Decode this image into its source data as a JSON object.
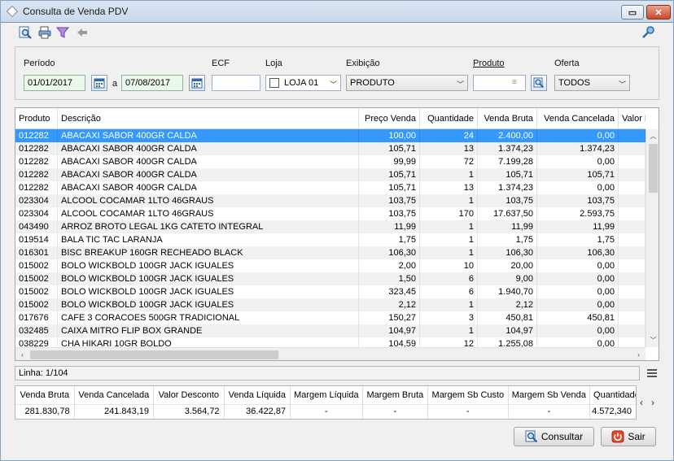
{
  "window": {
    "title": "Consulta de Venda PDV",
    "restore_label": "▭",
    "close_label": "✕"
  },
  "filters": {
    "periodo_label": "Período",
    "date_from": "01/01/2017",
    "separator": "a",
    "date_to": "07/08/2017",
    "ecf_label": "ECF",
    "ecf_value": "",
    "loja_label": "Loja",
    "loja_value": "LOJA 01",
    "exibicao_label": "Exibição",
    "exibicao_value": "PRODUTO",
    "produto_label": "Produto",
    "produto_value": "",
    "oferta_label": "Oferta",
    "oferta_value": "TODOS"
  },
  "grid": {
    "columns": [
      "Produto",
      "Descrição",
      "Preço Venda",
      "Quantidade",
      "Venda Bruta",
      "Venda Cancelada",
      "Valor D"
    ],
    "rows": [
      [
        "012282",
        "ABACAXI SABOR 400GR CALDA",
        "100,00",
        "24",
        "2.400,00",
        "0,00"
      ],
      [
        "012282",
        "ABACAXI SABOR 400GR CALDA",
        "105,71",
        "13",
        "1.374,23",
        "1.374,23"
      ],
      [
        "012282",
        "ABACAXI SABOR 400GR CALDA",
        "99,99",
        "72",
        "7.199,28",
        "0,00"
      ],
      [
        "012282",
        "ABACAXI SABOR 400GR CALDA",
        "105,71",
        "1",
        "105,71",
        "105,71"
      ],
      [
        "012282",
        "ABACAXI SABOR 400GR CALDA",
        "105,71",
        "13",
        "1.374,23",
        "0,00"
      ],
      [
        "023304",
        "ALCOOL COCAMAR 1LTO 46GRAUS",
        "103,75",
        "1",
        "103,75",
        "103,75"
      ],
      [
        "023304",
        "ALCOOL COCAMAR 1LTO 46GRAUS",
        "103,75",
        "170",
        "17.637,50",
        "2.593,75"
      ],
      [
        "043490",
        "ARROZ BROTO LEGAL 1KG CATETO INTEGRAL",
        "11,99",
        "1",
        "11,99",
        "11,99"
      ],
      [
        "019514",
        "BALA TIC TAC LARANJA",
        "1,75",
        "1",
        "1,75",
        "1,75"
      ],
      [
        "016301",
        "BISC BREAKUP 160GR RECHEADO BLACK",
        "106,30",
        "1",
        "106,30",
        "106,30"
      ],
      [
        "015002",
        "BOLO WICKBOLD 100GR JACK IGUALES",
        "2,00",
        "10",
        "20,00",
        "0,00"
      ],
      [
        "015002",
        "BOLO WICKBOLD 100GR JACK IGUALES",
        "1,50",
        "6",
        "9,00",
        "0,00"
      ],
      [
        "015002",
        "BOLO WICKBOLD 100GR JACK IGUALES",
        "323,45",
        "6",
        "1.940,70",
        "0,00"
      ],
      [
        "015002",
        "BOLO WICKBOLD 100GR JACK IGUALES",
        "2,12",
        "1",
        "2,12",
        "0,00"
      ],
      [
        "017676",
        "CAFE 3 CORACOES 500GR TRADICIONAL",
        "150,27",
        "3",
        "450,81",
        "450,81"
      ],
      [
        "032485",
        "CAIXA MITRO FLIP BOX GRANDE",
        "104,97",
        "1",
        "104,97",
        "0,00"
      ],
      [
        "038229",
        "CHA HIKARI 10GR BOLDO",
        "104,59",
        "12",
        "1.255,08",
        "0,00"
      ]
    ]
  },
  "status": {
    "linha": "Linha: 1/104"
  },
  "totals": {
    "headers": [
      "Venda Bruta",
      "Venda Cancelada",
      "Valor Desconto",
      "Venda Líquida",
      "Margem Líquida",
      "Margem Bruta",
      "Margem Sb Custo",
      "Margem Sb Venda",
      "Quantidade"
    ],
    "values": [
      "281.830,78",
      "241.843,19",
      "3.564,72",
      "36.422,87",
      "-",
      "-",
      "-",
      "-",
      "4.572,340"
    ]
  },
  "buttons": {
    "consultar": "Consultar",
    "sair": "Sair"
  },
  "colors": {
    "selection": "#3399ff",
    "close": "#c84a2c"
  }
}
